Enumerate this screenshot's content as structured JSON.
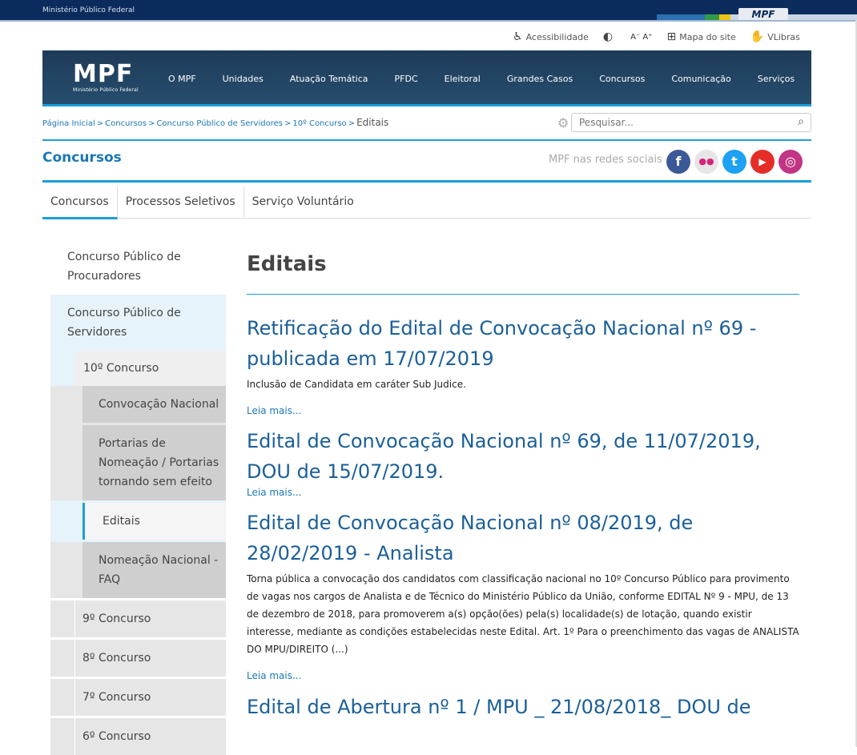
{
  "gov_bar": {
    "org_name": "Ministério Público Federal",
    "tab_label": "MPF"
  },
  "accessibility": {
    "items": [
      {
        "icon": "accessibility-icon",
        "label": "Acessibilidade"
      },
      {
        "icon": "contrast-icon",
        "label": ""
      },
      {
        "icon": "font-size-icon",
        "label": "A⁻ A⁺"
      },
      {
        "icon": "sitemap-icon",
        "label": "Mapa do site"
      },
      {
        "icon": "vlibras-icon",
        "label": "VLibras"
      }
    ]
  },
  "logo": {
    "text": "MPF",
    "subtitle": "Ministério Público Federal"
  },
  "menu": [
    "O MPF",
    "Unidades",
    "Atuação Temática",
    "PFDC",
    "Eleitoral",
    "Grandes Casos",
    "Concursos",
    "Comunicação",
    "Serviços"
  ],
  "breadcrumb": {
    "items": [
      "Página Inicial",
      "Concursos",
      "Concurso Público de Servidores",
      "10º Concurso"
    ],
    "separator": ">",
    "current": "Editais"
  },
  "search": {
    "placeholder": "Pesquisar..."
  },
  "section": {
    "title": "Concursos",
    "social_label": "MPF nas redes sociais"
  },
  "social": [
    {
      "name": "facebook",
      "glyph": "f",
      "color": "#3b5998"
    },
    {
      "name": "flickr",
      "glyph": "●●",
      "color": "#e6e6e6"
    },
    {
      "name": "twitter",
      "glyph": "t",
      "color": "#1da1f2"
    },
    {
      "name": "youtube",
      "glyph": "▶",
      "color": "#e52d27"
    },
    {
      "name": "instagram",
      "glyph": "◎",
      "color": "#c13584"
    }
  ],
  "subtabs": [
    "Concursos",
    "Processos Seletivos",
    "Serviço Voluntário"
  ],
  "sidenav": {
    "procuradores": "Concurso Público de Procuradores",
    "servidores": "Concurso Público de Servidores",
    "decimo": "10º Concurso",
    "sub": [
      "Convocação Nacional",
      "Portarias de Nomeação / Portarias tornando sem efeito",
      "Editais",
      "Nomeação Nacional - FAQ"
    ],
    "others": [
      "9º Concurso",
      "8º Concurso",
      "7º Concurso",
      "6º Concurso"
    ]
  },
  "main": {
    "title": "Editais",
    "items": [
      {
        "title": "Retificação do Edital de Convocação Nacional nº 69 - publicada em 17/07/2019",
        "desc": "Inclusão de Candidata em caráter Sub Judice.",
        "more": "Leia mais..."
      },
      {
        "title": "Edital de Convocação Nacional nº 69, de 11/07/2019, DOU de 15/07/2019.",
        "desc": "",
        "more": "Leia mais..."
      },
      {
        "title": "Edital de Convocação Nacional nº 08/2019, de 28/02/2019 - Analista",
        "desc": "Torna pública a convocação dos candidatos com classificação nacional no 10º Concurso Público para provimento de vagas nos cargos de Analista e de Técnico do Ministério Público da União, conforme EDITAL Nº 9 - MPU, de 13 de dezembro de 2018, para promoverem a(s) opção(ões) pela(s) localidade(s) de lotação, quando existir interesse, mediante as condições estabelecidas neste Edital. Art. 1º Para o preenchimento das vagas de ANALISTA DO MPU/DIREITO (...)",
        "more": "Leia mais..."
      },
      {
        "title": "Edital de Abertura nº 1 / MPU _ 21/08/2018_ DOU de",
        "desc": "",
        "more": ""
      }
    ]
  }
}
